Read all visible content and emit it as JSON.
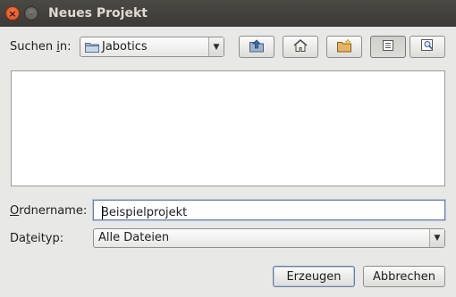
{
  "window": {
    "title": "Neues Projekt",
    "close_glyph": "×",
    "minimize_glyph": "–"
  },
  "look_in": {
    "label_pre": "Suchen ",
    "label_mnemonic": "i",
    "label_post": "n:",
    "value": "Jabotics",
    "icon": "folder-icon"
  },
  "toolbar": {
    "buttons": [
      {
        "name": "up-one-level",
        "icon": "folder-up-icon"
      },
      {
        "name": "home",
        "icon": "home-icon"
      },
      {
        "name": "new-folder",
        "icon": "new-folder-icon"
      },
      {
        "name": "list-view",
        "icon": "list-view-icon",
        "active": true
      },
      {
        "name": "details-view",
        "icon": "details-view-icon"
      }
    ]
  },
  "file_list": {
    "items": []
  },
  "folder_name": {
    "label_mnemonic": "O",
    "label_post": "rdnername:",
    "value": "Beispielprojekt"
  },
  "file_type": {
    "label_pre": "Da",
    "label_mnemonic": "t",
    "label_post": "eityp:",
    "value": "Alle Dateien"
  },
  "buttons": {
    "create": "Erzeugen",
    "cancel": "Abbrechen"
  },
  "colors": {
    "titlebar": "#3c3b37",
    "close_button": "#e85b2a",
    "dialog_bg": "#e8e8e7",
    "focus_border": "#6c7f9d"
  }
}
